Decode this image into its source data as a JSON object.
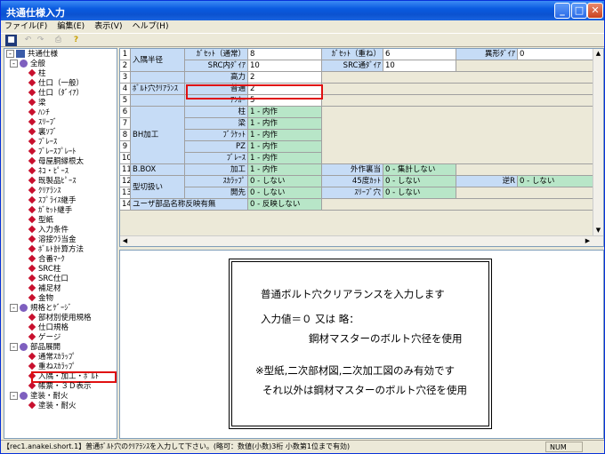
{
  "window": {
    "title": "共通仕様入力"
  },
  "menu": [
    "ファイル(F)",
    "編集(E)",
    "表示(V)",
    "ヘルプ(H)"
  ],
  "tree": [
    {
      "label": "共通仕様",
      "level": 0,
      "type": "root",
      "fold": "-"
    },
    {
      "label": "全般",
      "level": 1,
      "type": "folder",
      "fold": "-"
    },
    {
      "label": "柱",
      "level": 2,
      "type": "item"
    },
    {
      "label": "仕口（一般）",
      "level": 2,
      "type": "item"
    },
    {
      "label": "仕口（ﾀﾞｲｱ）",
      "level": 2,
      "type": "item"
    },
    {
      "label": "梁",
      "level": 2,
      "type": "item"
    },
    {
      "label": "ﾊﾝﾁ",
      "level": 2,
      "type": "item"
    },
    {
      "label": "ｽﾘｰﾌﾞ",
      "level": 2,
      "type": "item"
    },
    {
      "label": "裏ｿﾌﾞ",
      "level": 2,
      "type": "item"
    },
    {
      "label": "ﾌﾞﾚｰｽ",
      "level": 2,
      "type": "item"
    },
    {
      "label": "ﾌﾞﾚｰｽﾌﾟﾚｰﾄ",
      "level": 2,
      "type": "item"
    },
    {
      "label": "母屋胴縁根太",
      "level": 2,
      "type": "item"
    },
    {
      "label": "ﾈｺ・ﾋﾟｰｽ",
      "level": 2,
      "type": "item"
    },
    {
      "label": "既製品ﾋﾟｰｽ",
      "level": 2,
      "type": "item"
    },
    {
      "label": "ｸﾘｱﾗﾝｽ",
      "level": 2,
      "type": "item"
    },
    {
      "label": "ｽﾌﾟﾗｲｽ継手",
      "level": 2,
      "type": "item"
    },
    {
      "label": "ｶﾞｾｯﾄ継手",
      "level": 2,
      "type": "item"
    },
    {
      "label": "型紙",
      "level": 2,
      "type": "item"
    },
    {
      "label": "入力条件",
      "level": 2,
      "type": "item"
    },
    {
      "label": "溶接ｳﾗ当金",
      "level": 2,
      "type": "item"
    },
    {
      "label": "ﾎﾞﾙﾄ計算方法",
      "level": 2,
      "type": "item"
    },
    {
      "label": "合番ﾏｰｸ",
      "level": 2,
      "type": "item"
    },
    {
      "label": "SRC柱",
      "level": 2,
      "type": "item"
    },
    {
      "label": "SRC仕口",
      "level": 2,
      "type": "item"
    },
    {
      "label": "補足材",
      "level": 2,
      "type": "item"
    },
    {
      "label": "金物",
      "level": 2,
      "type": "item"
    },
    {
      "label": "規格とｹﾞｰｼﾞ",
      "level": 1,
      "type": "folder",
      "fold": "-"
    },
    {
      "label": "部材別使用規格",
      "level": 2,
      "type": "item"
    },
    {
      "label": "仕口規格",
      "level": 2,
      "type": "item"
    },
    {
      "label": "ゲージ",
      "level": 2,
      "type": "item"
    },
    {
      "label": "部品展開",
      "level": 1,
      "type": "folder",
      "fold": "-"
    },
    {
      "label": "通常ｽｶﾗｯﾌﾟ",
      "level": 2,
      "type": "item"
    },
    {
      "label": "重ねｽｶﾗｯﾌﾟ",
      "level": 2,
      "type": "item"
    },
    {
      "label": "入隅・加工・ﾎﾞﾙﾄ",
      "level": 2,
      "type": "selected"
    },
    {
      "label": "帳票・３Ｄ表示",
      "level": 2,
      "type": "item"
    },
    {
      "label": "塗装・耐火",
      "level": 1,
      "type": "folder",
      "fold": "-"
    },
    {
      "label": "塗装・耐火",
      "level": 2,
      "type": "item"
    }
  ],
  "grid": {
    "row_numbers": [
      "1",
      "2",
      "3",
      "4",
      "5",
      "6",
      "7",
      "8",
      "9",
      "10",
      "11",
      "12",
      "13",
      "14"
    ],
    "cells": {
      "r1_group": "入隅半径",
      "r1_a_label": "ｶﾞｾｯﾄ（通常）",
      "r1_a_val": "8",
      "r1_b_label": "ｶﾞｾｯﾄ（重ね）",
      "r1_b_val": "6",
      "r1_c_label": "異形ﾀﾞｲｱ",
      "r1_c_val": "0",
      "r2_a_label": "SRC内ﾀﾞｲｱ",
      "r2_a_val": "10",
      "r2_b_label": "SRC通ﾀﾞｲｱ",
      "r2_b_val": "10",
      "r3_label": "高力",
      "r3_val": "2",
      "r4_group": "ﾎﾞﾙﾄ穴ｸﾘｱﾗﾝｽ",
      "r4_label": "普通",
      "r4_val": "2",
      "r5_label": "ｱﾝｶｰ",
      "r5_val": "5",
      "bh_group": "BH加工",
      "r6_label": "柱",
      "r6_val": "1 - 内作",
      "r7_label": "梁",
      "r7_val": "1 - 内作",
      "r8_label": "ﾌﾞﾗｹｯﾄ",
      "r8_val": "1 - 内作",
      "r9_label": "PZ",
      "r9_val": "1 - 内作",
      "r10_label": "ﾌﾞﾚｰｽ",
      "r10_val": "1 - 内作",
      "r11_group": "B.BOX",
      "r11_label": "加工",
      "r11_val": "1 - 内作",
      "r11_b_label": "外作裏当",
      "r11_b_val": "0 - 集計しない",
      "r12_group": "型切扱い",
      "r12_label": "ｽｶﾗｯﾌﾟ",
      "r12_val": "0 - しない",
      "r12_b_label": "45度ｶｯﾄ",
      "r12_b_val": "0 - しない",
      "r12_c_label": "逆R",
      "r12_c_val": "0 - しない",
      "r13_label": "開先",
      "r13_val": "0 - しない",
      "r13_b_label": "ｽﾘｰﾌﾞ穴",
      "r13_b_val": "0 - しない",
      "r14_group": "ユーザ部品名称反映有無",
      "r14_val": "0 - 反映しない"
    }
  },
  "description": {
    "line1": "普通ボルト穴クリアランスを入力します",
    "line2": "入力値＝０ 又は 略：",
    "line3": "鋼材マスターのボルト穴径を使用",
    "line4": "※型紙,二次部材図,二次加工図のみ有効です",
    "line5": "それ以外は鋼材マスターのボルト穴径を使用"
  },
  "status": {
    "message": "【rec1.anakei.short.1】普通ﾎﾞﾙﾄ穴のｸﾘｱﾗﾝｽを入力して下さい。(略可：数値(小数)3桁 小数第1位まで有効)",
    "num": "NUM"
  },
  "colors": {
    "title_bar": "#0b52d0",
    "highlight": "#e01010",
    "green_cell": "#b8e6c8",
    "blue_cell": "#c6dcf6"
  }
}
